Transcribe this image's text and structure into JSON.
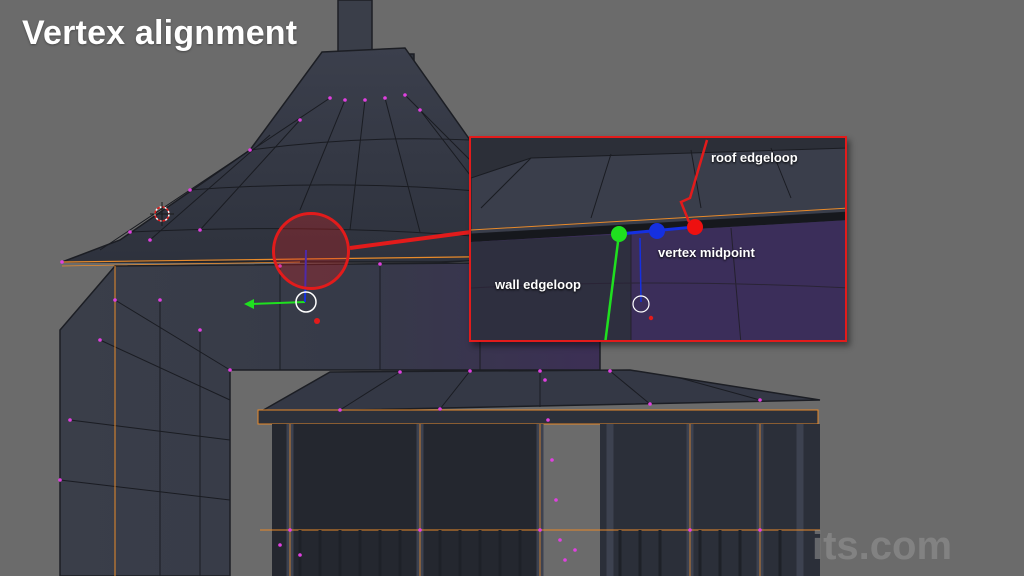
{
  "title": "Vertex alignment",
  "watermark": "its.com",
  "inset": {
    "roof_label": "roof edgeloop",
    "midpoint_label": "vertex midpoint",
    "wall_label": "wall edgeloop"
  },
  "colors": {
    "background": "#6b6b6b",
    "callout_red": "#e21b1b",
    "vertex_green": "#1fe01f",
    "vertex_blue": "#1530e0",
    "vertex_red": "#ee1010",
    "edge_orange": "#e88a2a",
    "vertex_magenta": "#e040e0",
    "wall_purple": "#5a3a78"
  },
  "icons": {
    "cursor": "3d-cursor-icon",
    "gizmo": "transform-gizmo-icon"
  }
}
